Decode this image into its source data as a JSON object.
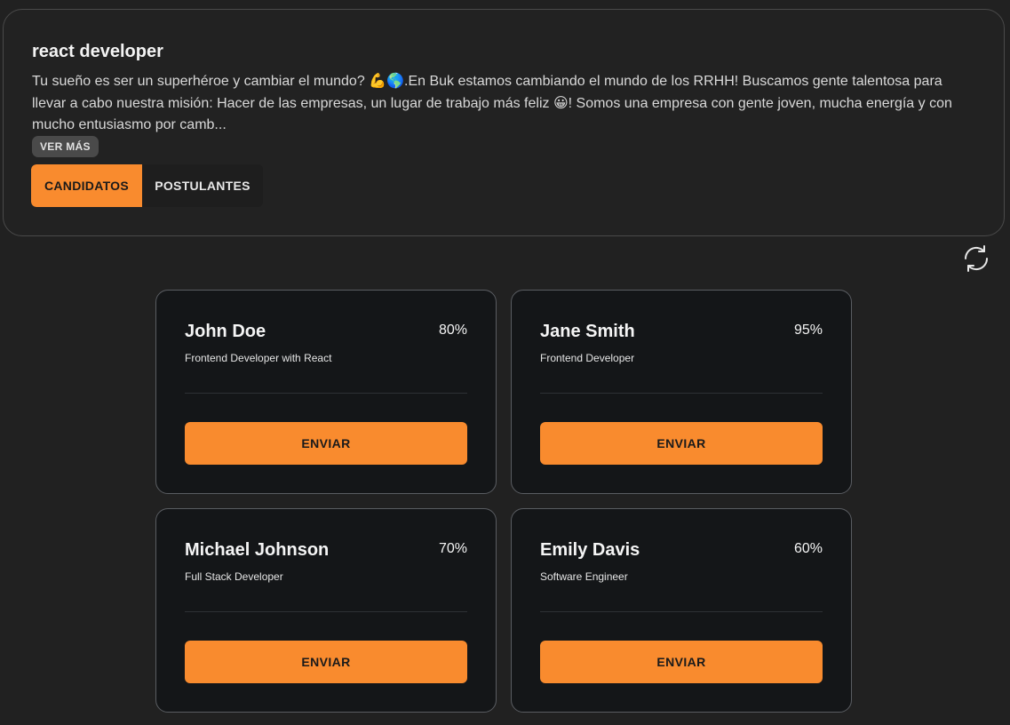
{
  "job": {
    "title": "react developer",
    "description": "Tu sueño es ser un superhéroe y cambiar el mundo? 💪🌎.En Buk estamos cambiando el mundo de los RRHH! Buscamos gente talentosa para llevar a cabo nuestra misión: Hacer de las empresas, un lugar de trabajo más feliz 😀! Somos una empresa con gente joven, mucha energía y con mucho entusiasmo por camb...",
    "ver_mas_label": "VER MÁS"
  },
  "tabs": [
    {
      "label": "CANDIDATOS",
      "active": true
    },
    {
      "label": "POSTULANTES",
      "active": false
    }
  ],
  "refresh_icon": "refresh-icon",
  "candidates": [
    {
      "name": "John Doe",
      "score": "80%",
      "role": "Frontend Developer with React",
      "button": "ENVIAR"
    },
    {
      "name": "Jane Smith",
      "score": "95%",
      "role": "Frontend Developer",
      "button": "ENVIAR"
    },
    {
      "name": "Michael Johnson",
      "score": "70%",
      "role": "Full Stack Developer",
      "button": "ENVIAR"
    },
    {
      "name": "Emily Davis",
      "score": "60%",
      "role": "Software Engineer",
      "button": "ENVIAR"
    }
  ],
  "colors": {
    "accent": "#f98b2e",
    "background": "#212121",
    "card_bg": "#141618"
  }
}
